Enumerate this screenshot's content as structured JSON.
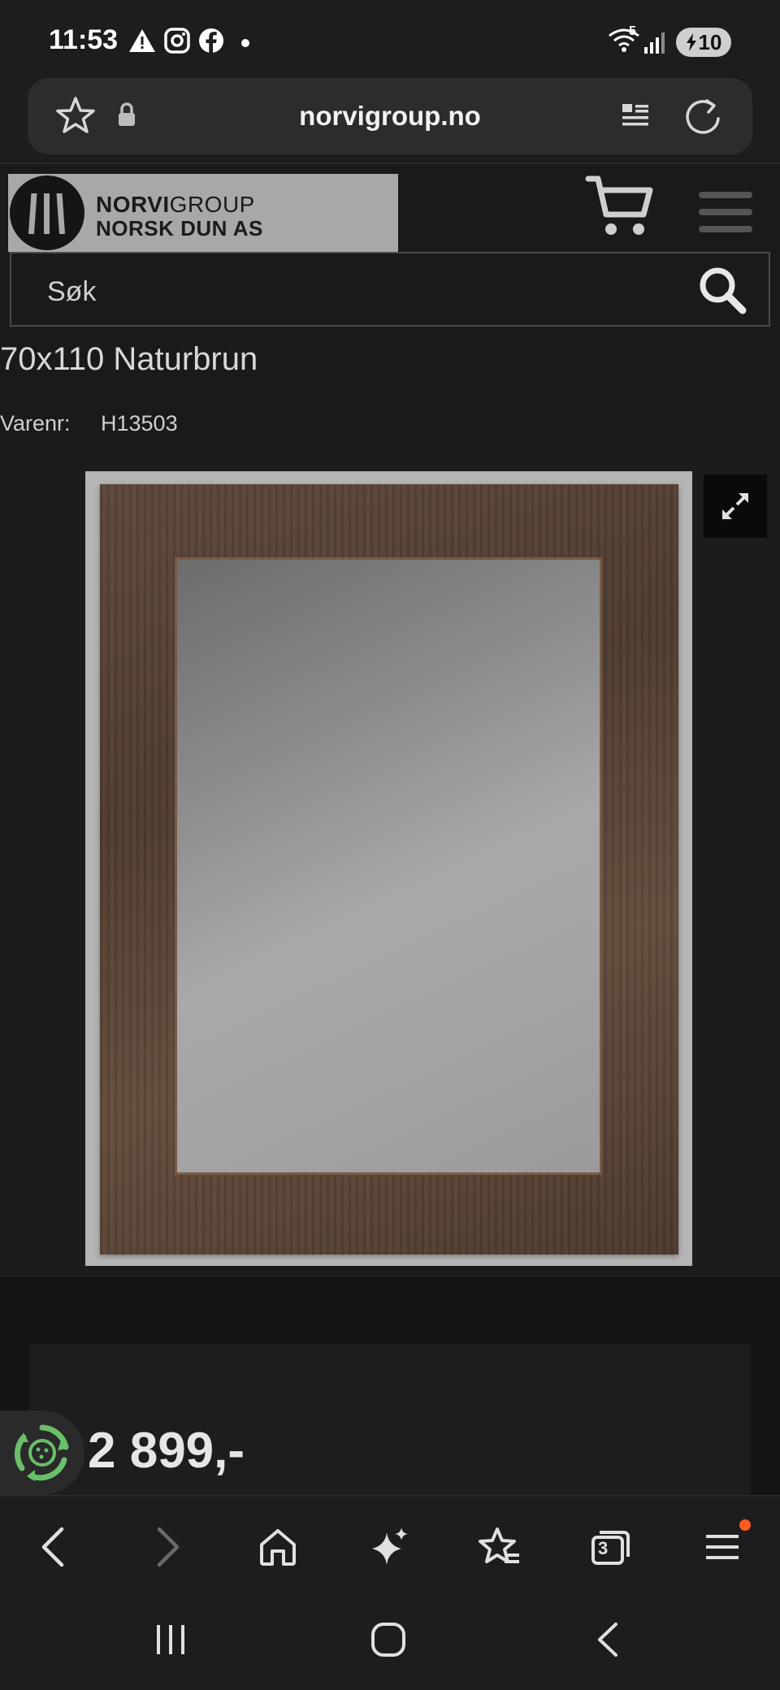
{
  "status_bar": {
    "time": "11:53",
    "left_icons": [
      "warning-icon",
      "instagram-icon",
      "facebook-icon",
      "dot-icon"
    ],
    "right_icons": [
      "wifi-icon",
      "signal-icon"
    ],
    "wifi_label": "5",
    "battery_level": "10"
  },
  "browser": {
    "url": "norvigroup.no",
    "bookmark_icon": "star-icon",
    "lock_icon": "lock-icon",
    "reader_icon": "reader-mode-icon",
    "reload_icon": "reload-icon"
  },
  "header": {
    "logo_line1_bold": "NORVI",
    "logo_line1_light": "GROUP",
    "logo_line2": "NORSK DUN AS",
    "search_placeholder": "Søk"
  },
  "product": {
    "title": "70x110 Naturbrun",
    "sku_label": "Varenr:",
    "sku_value": "H13503",
    "price": "2 899,-"
  },
  "toolbar": {
    "tab_count": "3",
    "items": [
      "back-icon",
      "forward-icon",
      "home-icon",
      "ai-sparkle-icon",
      "bookmarks-icon",
      "tabs-icon",
      "menu-icon"
    ]
  },
  "system_nav": {
    "items": [
      "recents-icon",
      "home-icon",
      "back-icon"
    ]
  },
  "colors": {
    "background": "#141416",
    "header": "#1a1a1c",
    "logo_box": "#a8a8a8",
    "frame_wood": "#5a4538",
    "eco_green": "#6abf69",
    "notification": "#ff5a1f"
  }
}
